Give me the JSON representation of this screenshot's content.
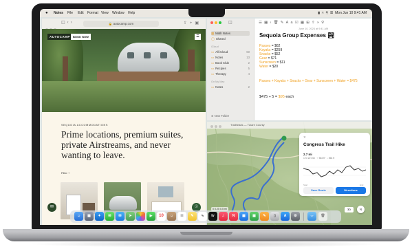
{
  "menubar": {
    "apple": "",
    "items": [
      "Notes",
      "File",
      "Edit",
      "Format",
      "View",
      "Window",
      "Help"
    ],
    "clock": "Mon Jun 10  9:41 AM"
  },
  "safari": {
    "address": "autocamp.com",
    "logo": "AUTOCAMP",
    "book_now": "BOOK NOW",
    "eyebrow": "SEQUOIA ACCOMMODATIONS",
    "headline": "Prime locations, premium suites, private Airstreams, and never wanting to leave.",
    "filter": "Filter +"
  },
  "notes": {
    "sidebar": {
      "top_items": [
        {
          "label": "Math Notes",
          "count": ""
        },
        {
          "label": "Shared",
          "count": ""
        }
      ],
      "icloud_header": "iCloud",
      "folders": [
        {
          "label": "All iCloud",
          "count": "60"
        },
        {
          "label": "Notes",
          "count": "13"
        },
        {
          "label": "Book Club",
          "count": "2"
        },
        {
          "label": "Recipes",
          "count": "5"
        },
        {
          "label": "Therapy",
          "count": "4"
        }
      ],
      "mac_header": "On My Mac",
      "mac_folders": [
        {
          "label": "Notes",
          "count": "2"
        }
      ],
      "new_folder": "New Folder"
    },
    "date": "June 10, 2024 at 9:41 AM",
    "title": "Sequoia Group Expenses 🏞",
    "lines": [
      {
        "label": "Passes",
        "value": "$62"
      },
      {
        "label": "Kayaks",
        "value": "$259"
      },
      {
        "label": "Snacks",
        "value": "$52"
      },
      {
        "label": "Gear",
        "value": "$71"
      },
      {
        "label": "Sunscreen",
        "value": "$11"
      },
      {
        "label": "Water",
        "value": "$20"
      }
    ],
    "sum_line": "Passes + Kayaks + Snacks + Gear + Sunscreen + Water = $475",
    "result_prefix": "$475 ÷ 5 = ",
    "result_value": "$95",
    "result_suffix": " each"
  },
  "maps": {
    "title": "Trailheads — Tulare County",
    "trail": {
      "title": "Congress Trail Hike",
      "distance": "2.7 mi",
      "sub": "1 hr 22 min · ↑ 564 ft · ↓ 564 ft",
      "elev_low": "Start",
      "elev_high": "End",
      "save": "Save Route",
      "directions": "Directions"
    },
    "scale": "0  0.25  0.5 mi",
    "zoom": "3D",
    "compass": "N"
  },
  "dock": {
    "icons": [
      "finder-icon",
      "launchpad-icon",
      "safari-icon",
      "messages-icon",
      "mail-icon",
      "maps-icon",
      "photos-icon",
      "facetime-icon",
      "calendar-icon",
      "contacts-icon",
      "reminders-icon",
      "notes-icon",
      "freeform-icon",
      "tv-icon",
      "music-icon",
      "news-icon",
      "keynote-icon",
      "numbers-icon",
      "pages-icon",
      "appstore-icon",
      "settings-icon",
      "downloads-icon",
      "trash-icon"
    ],
    "calendar_day": "10"
  },
  "colors": {
    "accent": "#f0a01f",
    "maps_blue": "#1a78e6",
    "route": "#3a6fd0"
  }
}
